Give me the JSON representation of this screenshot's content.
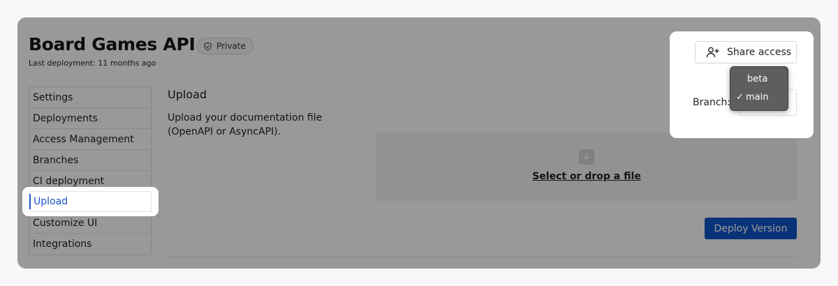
{
  "header": {
    "title": "Board Games API",
    "badge": "Private",
    "subtitle": "Last deployment: 11 months ago"
  },
  "sidebar": {
    "items": [
      {
        "label": "Settings"
      },
      {
        "label": "Deployments"
      },
      {
        "label": "Access Management"
      },
      {
        "label": "Branches"
      },
      {
        "label": "CI deployment"
      },
      {
        "label": "Upload",
        "active": true
      },
      {
        "label": "Customize UI"
      },
      {
        "label": "Integrations"
      }
    ]
  },
  "main": {
    "section_title": "Upload",
    "description": "Upload your documentation file (OpenAPI or AsyncAPI).",
    "dropzone_link": "Select or drop a file",
    "deploy_button": "Deploy Version"
  },
  "panel": {
    "share_button": "Share access",
    "branch_label": "Branch:",
    "branch_options": [
      "beta",
      "main"
    ],
    "selected_branch": "main",
    "check_glyph": "✓"
  },
  "colors": {
    "accent": "#1a56c9",
    "deploy_button": "#0f56c8"
  }
}
